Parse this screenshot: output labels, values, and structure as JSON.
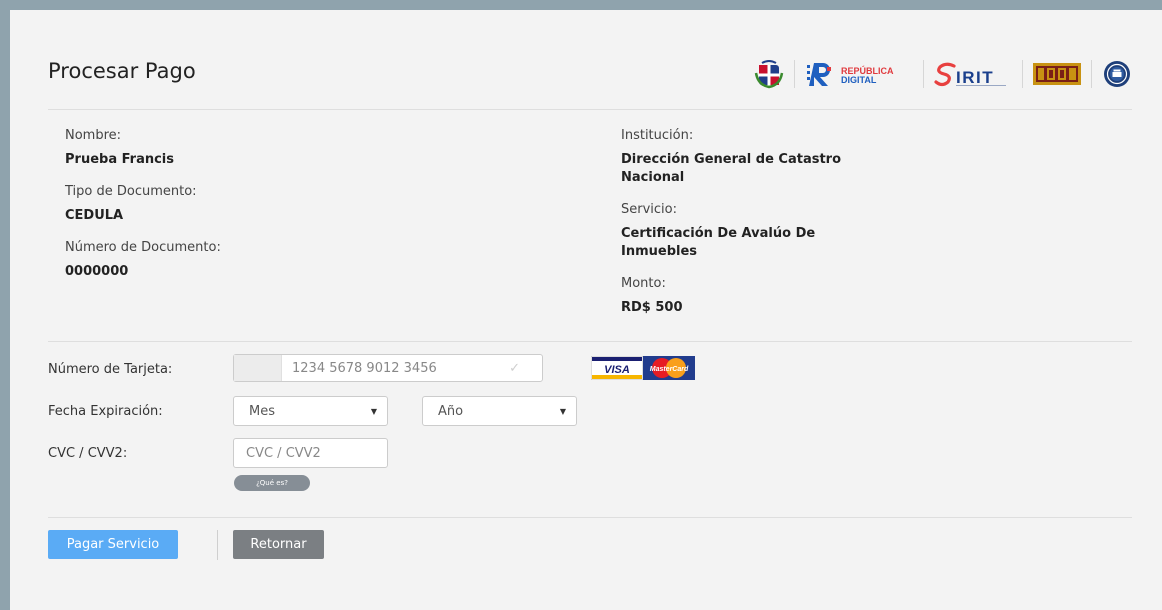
{
  "header": {
    "title": "Procesar Pago",
    "logos": [
      "coat-of-arms",
      "republica-digital",
      "sirit",
      "institution-logo",
      "seal"
    ],
    "republica_digital_line1": "REPÚBLICA",
    "republica_digital_line2": "DIGITAL",
    "sirit_text": "IRIT"
  },
  "payer": {
    "name_label": "Nombre:",
    "name_value": "Prueba Francis",
    "doc_type_label": "Tipo de Documento:",
    "doc_type_value": "CEDULA",
    "doc_number_label": "Número de Documento:",
    "doc_number_value": "0000000"
  },
  "service": {
    "institution_label": "Institución:",
    "institution_value": "Dirección General de Catastro Nacional",
    "service_label": "Servicio:",
    "service_value": "Certificación De Avalúo De Inmuebles",
    "amount_label": "Monto:",
    "amount_value": "RD$ 500"
  },
  "form": {
    "card_number_label": "Número de Tarjeta:",
    "card_number_placeholder": "1234 5678 9012 3456",
    "card_brands": [
      "VISA",
      "MasterCard"
    ],
    "expiry_label": "Fecha Expiración:",
    "month_selected": "Mes",
    "year_selected": "Año",
    "cvc_label": "CVC / CVV2:",
    "cvc_placeholder": "CVC / CVV2",
    "whats_this_label": "¿Qué es?"
  },
  "actions": {
    "pay_label": "Pagar Servicio",
    "back_label": "Retornar"
  },
  "colors": {
    "pay_button": "#5aabf5",
    "back_button": "#7b7f83",
    "card_background": "#f3f3f3",
    "outer_background": "#8fa3ad"
  }
}
